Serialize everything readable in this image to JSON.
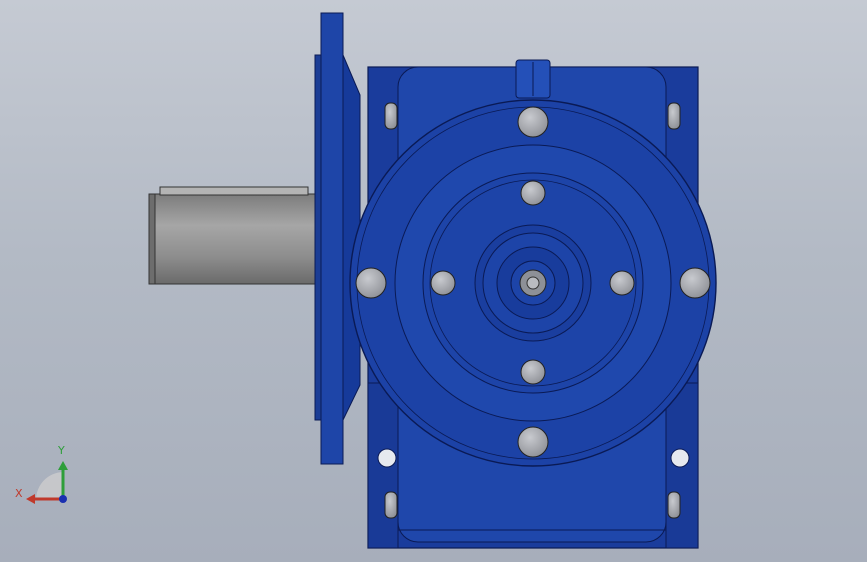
{
  "viewport": {
    "background_top": "#c5cad3",
    "background_bottom": "#a7aebb"
  },
  "model": {
    "body_color": "#1a3d9e",
    "body_dark": "#0b1f6b",
    "shaft_color": "#9a9a9a",
    "bolt_color": "#a8aab0"
  },
  "triad": {
    "x_label": "X",
    "y_label": "Y",
    "x_color": "#c0392b",
    "y_color": "#2e9e3a",
    "z_color": "#1a2fb0"
  }
}
